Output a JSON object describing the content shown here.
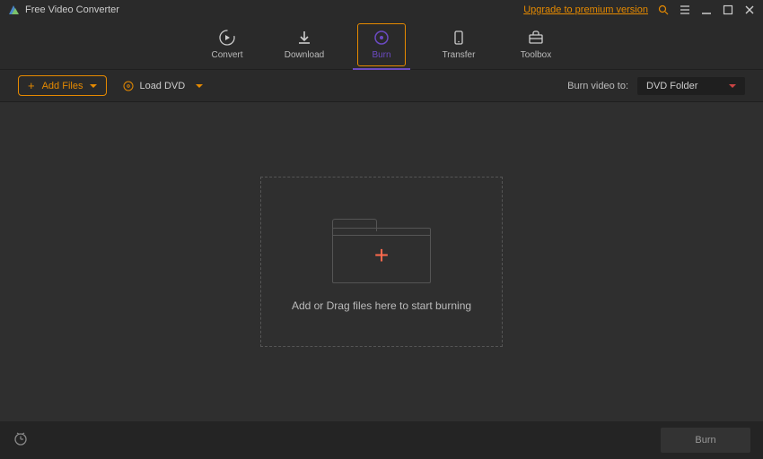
{
  "titlebar": {
    "title": "Free Video Converter",
    "upgrade": "Upgrade to premium version"
  },
  "tabs": {
    "convert": "Convert",
    "download": "Download",
    "burn": "Burn",
    "transfer": "Transfer",
    "toolbox": "Toolbox"
  },
  "subbar": {
    "add_files": "Add Files",
    "load_dvd": "Load DVD",
    "burn_to_label": "Burn video to:",
    "burn_to_value": "DVD Folder"
  },
  "dropzone": {
    "hint": "Add or Drag files here to start burning"
  },
  "bottom": {
    "burn_label": "Burn"
  }
}
